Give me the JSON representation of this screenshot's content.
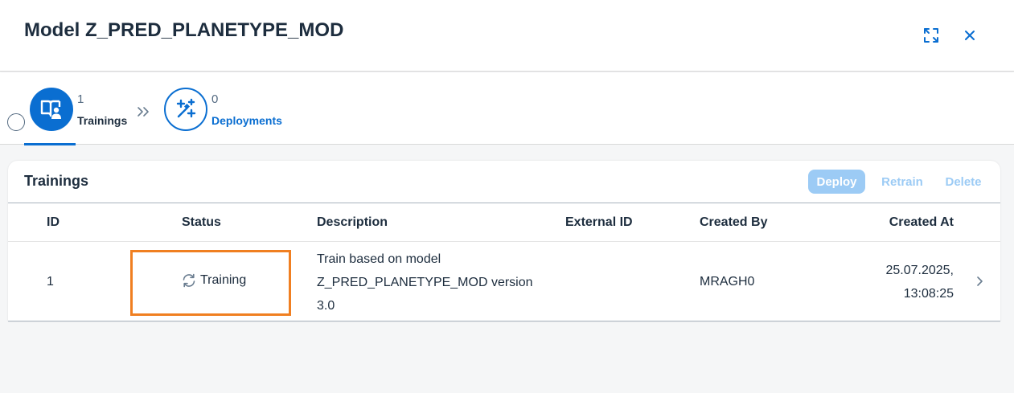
{
  "header": {
    "title": "Model Z_PRED_PLANETYPE_MOD",
    "expand_icon": "expand-icon",
    "close_icon": "close-icon"
  },
  "steps": [
    {
      "count": "1",
      "label": "Trainings",
      "icon": "learning-book-icon",
      "selected": true
    },
    {
      "count": "0",
      "label": "Deployments",
      "icon": "magic-wand-icon",
      "selected": false
    }
  ],
  "card": {
    "title": "Trainings",
    "buttons": {
      "deploy": "Deploy",
      "retrain": "Retrain",
      "delete": "Delete"
    },
    "columns": {
      "id": "ID",
      "status": "Status",
      "description": "Description",
      "external_id": "External ID",
      "created_by": "Created By",
      "created_at": "Created At"
    },
    "rows": [
      {
        "id": "1",
        "status": "Training",
        "status_icon": "refresh-icon",
        "description_line1": "Train based on model",
        "description_line2": "Z_PRED_PLANETYPE_MOD version",
        "description_line3": "3.0",
        "external_id": "",
        "created_by": "MRAGH0",
        "created_at_line1": "25.07.2025,",
        "created_at_line2": "13:08:25"
      }
    ]
  },
  "colors": {
    "accent": "#0a6ed1",
    "disabled_accent": "#9ccbf5",
    "highlight": "#f07f21",
    "text": "#1d2d3e"
  }
}
